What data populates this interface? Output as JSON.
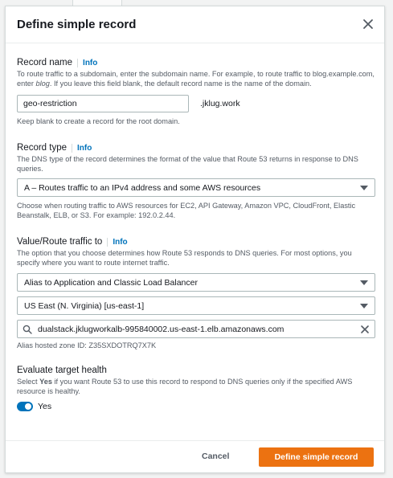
{
  "modal": {
    "title": "Define simple record"
  },
  "record_name": {
    "label": "Record name",
    "info": "Info",
    "description": "To route traffic to a subdomain, enter the subdomain name. For example, to route traffic to blog.example.com, enter blog. If you leave this field blank, the default record name is the name of the domain.",
    "value": "geo-restriction",
    "suffix": ".jklug.work",
    "hint": "Keep blank to create a record for the root domain."
  },
  "record_type": {
    "label": "Record type",
    "info": "Info",
    "description": "The DNS type of the record determines the format of the value that Route 53 returns in response to DNS queries.",
    "selected": "A – Routes traffic to an IPv4 address and some AWS resources",
    "hint": "Choose when routing traffic to AWS resources for EC2, API Gateway, Amazon VPC, CloudFront, Elastic Beanstalk, ELB, or S3. For example: 192.0.2.44."
  },
  "value_route": {
    "label": "Value/Route traffic to",
    "info": "Info",
    "description": "The option that you choose determines how Route 53 responds to DNS queries. For most options, you specify where you want to route internet traffic.",
    "endpoint_selected": "Alias to Application and Classic Load Balancer",
    "region_selected": "US East (N. Virginia) [us-east-1]",
    "search_value": "dualstack.jklugworkalb-995840002.us-east-1.elb.amazonaws.com",
    "hosted_zone": "Alias hosted zone ID: Z35SXDOTRQ7X7K"
  },
  "health": {
    "label": "Evaluate target health",
    "description": "Select Yes if you want Route 53 to use this record to respond to DNS queries only if the specified AWS resource is healthy.",
    "toggle_label": "Yes",
    "toggle_on": true
  },
  "footer": {
    "cancel": "Cancel",
    "submit": "Define simple record"
  },
  "colors": {
    "primary": "#ec7211",
    "link": "#0073bb",
    "toggle": "#0073bb"
  },
  "icons": [
    "close-icon",
    "chevron-down-icon",
    "search-icon",
    "clear-icon"
  ]
}
